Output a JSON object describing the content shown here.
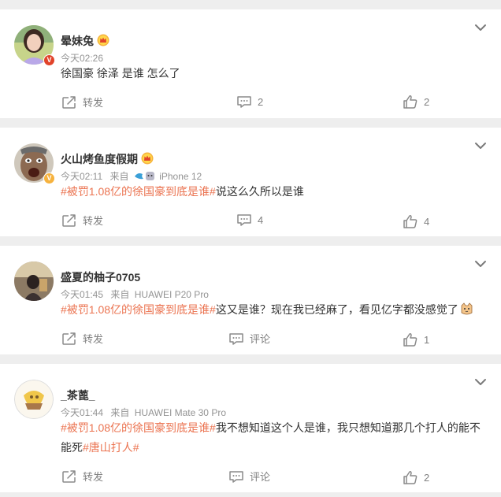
{
  "posts": [
    {
      "username": "晕妹兔",
      "badge": "V",
      "badge_color": "#e1432a",
      "meta": "今天02:26",
      "content_plain": "徐国豪 徐泽 是谁 怎么了",
      "repost": "转发",
      "comment": "2",
      "like": "2"
    },
    {
      "username": "火山烤鱼度假期",
      "badge": "V",
      "badge_color": "#f6b23e",
      "meta": "今天02:11",
      "source_prefix": "来自",
      "source": "iPhone 12",
      "tag": "#被罚1.08亿的徐国豪到底是谁#",
      "content_rest": "说这么久所以是谁",
      "repost": "转发",
      "comment": "4",
      "like": "4"
    },
    {
      "username": "盛夏的柚子0705",
      "meta": "今天01:45",
      "source_prefix": "来自",
      "source": "HUAWEI P20 Pro",
      "tag": "#被罚1.08亿的徐国豪到底是谁#",
      "content_rest": "这又是谁？现在我已经麻了，看见亿字都没感觉了",
      "repost": "转发",
      "comment": "评论",
      "like": "1"
    },
    {
      "username": "_茶蓖_",
      "meta": "今天01:44",
      "source_prefix": "来自",
      "source": "HUAWEI Mate 30 Pro",
      "tag": "#被罚1.08亿的徐国豪到底是谁#",
      "content_rest_1": "我不想知道这个人是谁，我只想知道那几个打人的能不",
      "content_rest_2": "能死",
      "tag2": "#唐山打人#",
      "repost": "转发",
      "comment": "评论",
      "like": "2"
    }
  ],
  "colors": {
    "accent_tag": "#eb7350",
    "meta_gray": "#939393",
    "divider_bg": "#eeeeee",
    "crown_gold": "#f6b23e"
  },
  "icons": [
    "chevron-down-icon",
    "repost-icon",
    "comment-icon",
    "like-icon",
    "crown-badge-icon",
    "verified-badge-icon",
    "source-emoji-icon",
    "cat-emoji-icon"
  ]
}
